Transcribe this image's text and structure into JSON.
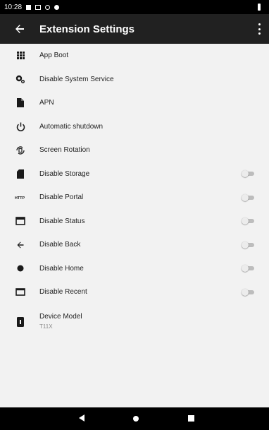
{
  "status_bar": {
    "time": "10:28"
  },
  "app_bar": {
    "title": "Extension Settings",
    "back_icon": "arrow-left-icon",
    "menu_icon": "more-vert-icon"
  },
  "settings": [
    {
      "label": "App Boot",
      "icon": "apps-grid-icon"
    },
    {
      "label": "Disable System Service",
      "icon": "settings-gears-icon"
    },
    {
      "label": "APN",
      "icon": "file-icon"
    },
    {
      "label": "Automatic shutdown",
      "icon": "power-icon"
    },
    {
      "label": "Screen Rotation",
      "icon": "screen-rotation-icon"
    },
    {
      "label": "Disable Storage",
      "icon": "sd-card-icon",
      "toggle": false
    },
    {
      "label": "Disable Portal",
      "icon": "http-icon",
      "icon_text": "HTTP",
      "toggle": false
    },
    {
      "label": "Disable Status",
      "icon": "status-window-icon",
      "toggle": false
    },
    {
      "label": "Disable Back",
      "icon": "arrow-left-icon",
      "toggle": false
    },
    {
      "label": "Disable Home",
      "icon": "home-dot-icon",
      "toggle": false
    },
    {
      "label": "Disable Recent",
      "icon": "recent-window-icon",
      "toggle": false
    },
    {
      "label": "Device Model",
      "value": "T11X",
      "icon": "device-info-icon"
    }
  ],
  "nav_bar": {
    "back": "nav-back-icon",
    "home": "nav-home-icon",
    "recent": "nav-recent-icon"
  },
  "colors": {
    "app_bar": "#212121",
    "background": "#f2f2f2",
    "icon": "#1a1a1a",
    "toggle_off": "#bdbdbd"
  }
}
